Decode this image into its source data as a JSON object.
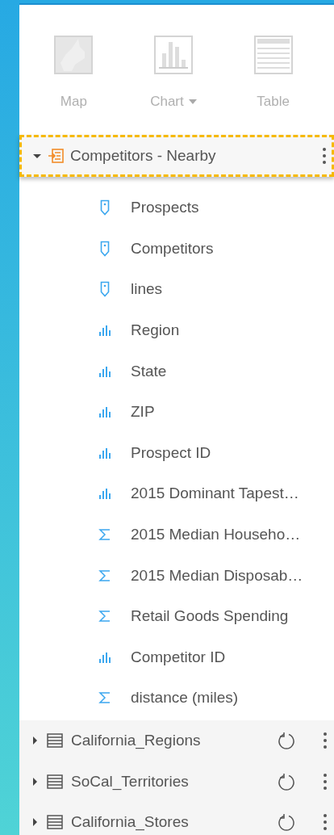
{
  "toolbar": [
    {
      "kind": "map",
      "label": "Map",
      "dropdown": false
    },
    {
      "kind": "chart",
      "label": "Chart",
      "dropdown": true
    },
    {
      "kind": "table",
      "label": "Table",
      "dropdown": false
    }
  ],
  "dataset": {
    "name": "Competitors - Nearby",
    "expanded": true,
    "selected": true,
    "fields": [
      {
        "kind": "location",
        "name": "Prospects"
      },
      {
        "kind": "location",
        "name": "Competitors"
      },
      {
        "kind": "location",
        "name": "lines"
      },
      {
        "kind": "string",
        "name": "Region"
      },
      {
        "kind": "string",
        "name": "State"
      },
      {
        "kind": "string",
        "name": "ZIP"
      },
      {
        "kind": "string",
        "name": "Prospect ID"
      },
      {
        "kind": "string",
        "name": "2015 Dominant Tapest…"
      },
      {
        "kind": "number",
        "name": "2015 Median Househo…"
      },
      {
        "kind": "number",
        "name": "2015 Median Disposab…"
      },
      {
        "kind": "number",
        "name": "Retail Goods Spending"
      },
      {
        "kind": "string",
        "name": "Competitor ID"
      },
      {
        "kind": "number",
        "name": "distance (miles)"
      }
    ]
  },
  "other_datasets": [
    {
      "name": "California_Regions",
      "expanded": false
    },
    {
      "name": "SoCal_Territories",
      "expanded": false
    },
    {
      "name": "California_Stores",
      "expanded": false
    }
  ]
}
